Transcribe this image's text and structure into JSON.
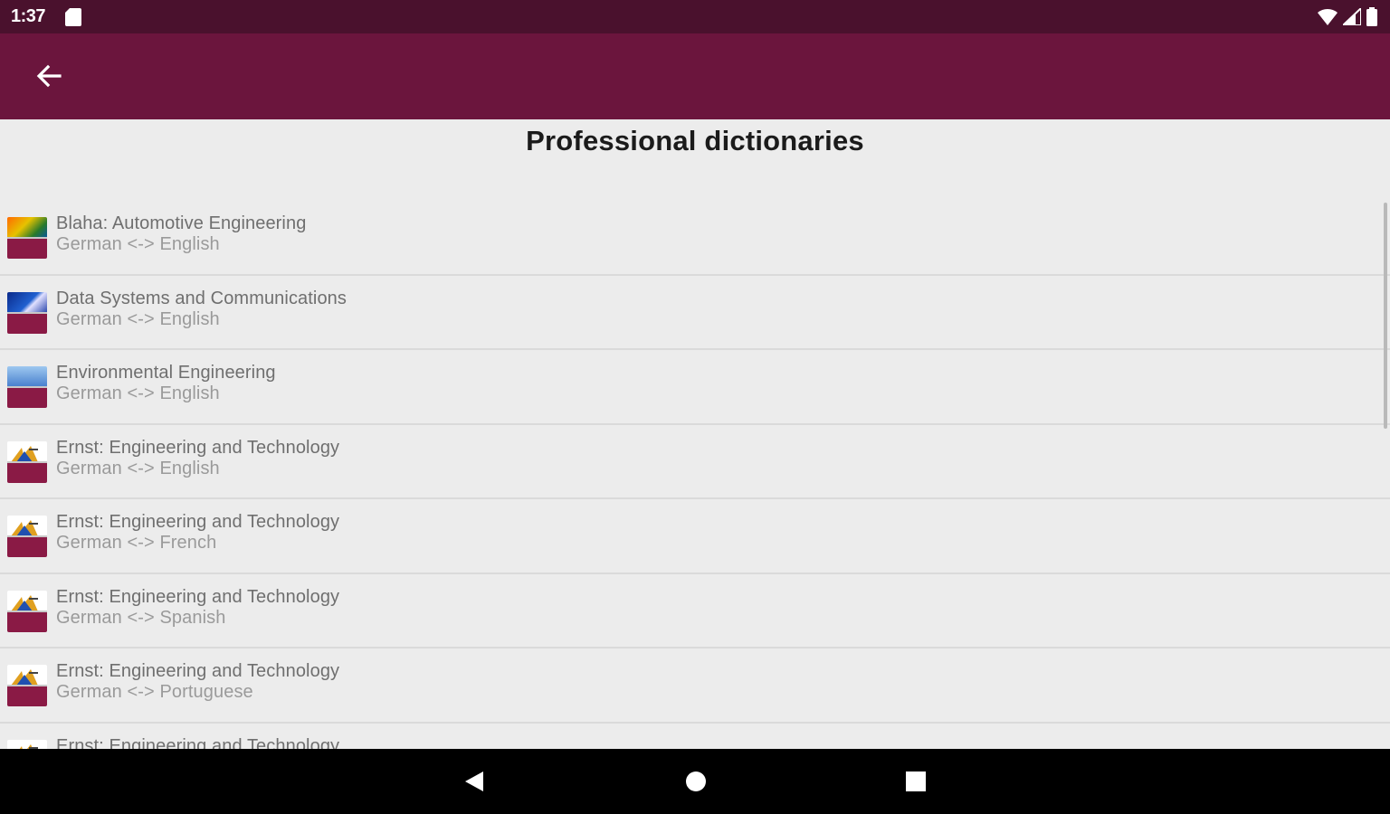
{
  "status_bar": {
    "time": "1:37",
    "icons": [
      "sd-card-icon",
      "wifi-icon",
      "signal-icon",
      "battery-icon"
    ]
  },
  "app_bar": {
    "back_icon": "arrow-left-icon",
    "color": "#6b153d"
  },
  "page": {
    "title": "Professional dictionaries"
  },
  "dictionaries": [
    {
      "title": "Blaha: Automotive Engineering",
      "languages": "German <-> English",
      "thumb": "pons"
    },
    {
      "title": "Data Systems and Communications",
      "languages": "German <-> English",
      "thumb": "data"
    },
    {
      "title": "Environmental Engineering",
      "languages": "German <-> English",
      "thumb": "env"
    },
    {
      "title": "Ernst: Engineering and Technology",
      "languages": "German <-> English",
      "thumb": "ernst"
    },
    {
      "title": "Ernst: Engineering and Technology",
      "languages": "German <-> French",
      "thumb": "ernst"
    },
    {
      "title": "Ernst: Engineering and Technology",
      "languages": "German <-> Spanish",
      "thumb": "ernst"
    },
    {
      "title": "Ernst: Engineering and Technology",
      "languages": "German <-> Portuguese",
      "thumb": "ernst"
    },
    {
      "title": "Ernst: Engineering and Technology",
      "languages": "",
      "thumb": "ernst"
    }
  ],
  "nav_bar": {
    "icons": [
      "nav-back-icon",
      "nav-home-icon",
      "nav-recents-icon"
    ]
  },
  "colors": {
    "status_bar": "#4a112d",
    "app_bar": "#6b153d",
    "background": "#ececec"
  }
}
